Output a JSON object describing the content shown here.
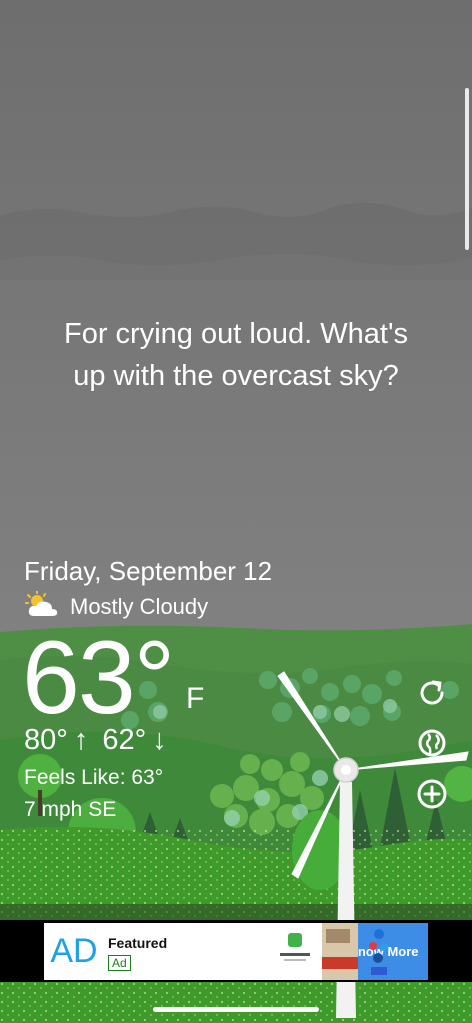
{
  "message": {
    "line1": "For crying out loud. What's",
    "line2": "up with the overcast sky?"
  },
  "weather": {
    "date": "Friday, September 12",
    "condition": "Mostly Cloudy",
    "condition_icon": "partly-cloudy-icon",
    "temperature": "63°",
    "unit": "F",
    "high": "80°",
    "high_arrow": "↑",
    "low": "62°",
    "low_arrow": "↓",
    "feels_like": "Feels Like: 63°",
    "wind": "7 mph SE"
  },
  "actions": {
    "refresh_icon": "refresh-icon",
    "location_icon": "globe-location-icon",
    "add_icon": "add-location-icon"
  },
  "ad": {
    "logo": "AD",
    "featured": "Featured",
    "badge": "Ad",
    "cta": "Know More"
  },
  "colors": {
    "sky": "#7d7d7d",
    "hills": "#4f8f45",
    "grass": "#3f9a2c",
    "cta": "#3d8de7"
  }
}
